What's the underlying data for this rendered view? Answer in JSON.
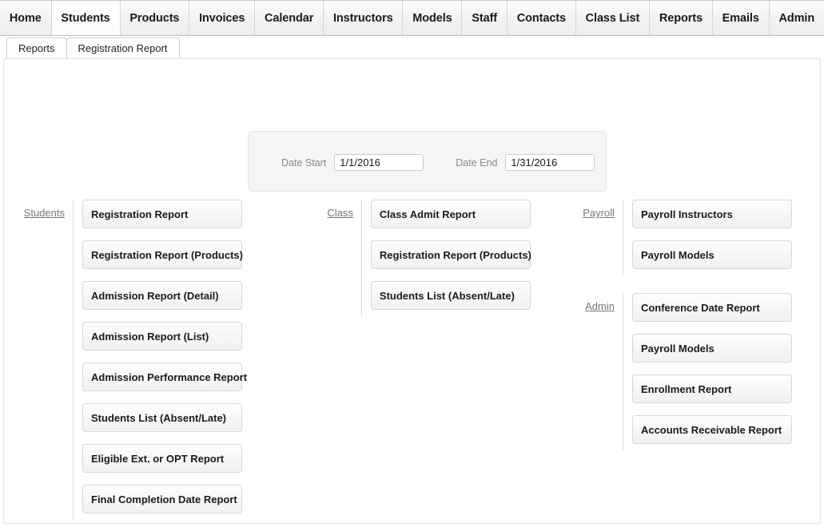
{
  "topnav": {
    "items": [
      {
        "label": "Home",
        "active": false
      },
      {
        "label": "Students",
        "active": true
      },
      {
        "label": "Products",
        "active": false
      },
      {
        "label": "Invoices",
        "active": false
      },
      {
        "label": "Calendar",
        "active": false
      },
      {
        "label": "Instructors",
        "active": false
      },
      {
        "label": "Models",
        "active": false
      },
      {
        "label": "Staff",
        "active": false
      },
      {
        "label": "Contacts",
        "active": false
      },
      {
        "label": "Class List",
        "active": false
      },
      {
        "label": "Reports",
        "active": false
      },
      {
        "label": "Emails",
        "active": false
      },
      {
        "label": "Admin",
        "active": false
      }
    ]
  },
  "tabs": [
    {
      "label": "Reports",
      "active": true
    },
    {
      "label": "Registration Report",
      "active": false
    }
  ],
  "filter": {
    "date_start_label": "Date Start",
    "date_start_value": "1/1/2016",
    "date_start_placeholder": "",
    "date_end_label": "Date End",
    "date_end_value": "1/31/2016",
    "date_end_placeholder": ""
  },
  "groups": {
    "students": {
      "label": "Students",
      "buttons": [
        "Registration Report",
        "Registration Report (Products)",
        "Admission Report (Detail)",
        "Admission Report (List)",
        "Admission Performance Report",
        "Students List (Absent/Late)",
        "Eligible Ext. or OPT Report",
        "Final Completion Date Report"
      ]
    },
    "class": {
      "label": "Class",
      "buttons": [
        "Class Admit Report",
        "Registration Report (Products)",
        "Students List (Absent/Late)"
      ]
    },
    "payroll": {
      "label": "Payroll",
      "buttons": [
        "Payroll Instructors",
        "Payroll Models"
      ]
    },
    "admin": {
      "label": "Admin",
      "buttons": [
        "Conference Date Report",
        "Payroll Models",
        "Enrollment Report",
        "Accounts Receivable Report"
      ]
    }
  },
  "colors": {
    "button_border": "#d6d6d6",
    "group_label": "#777777",
    "panel_bg": "#f5f5f5"
  }
}
